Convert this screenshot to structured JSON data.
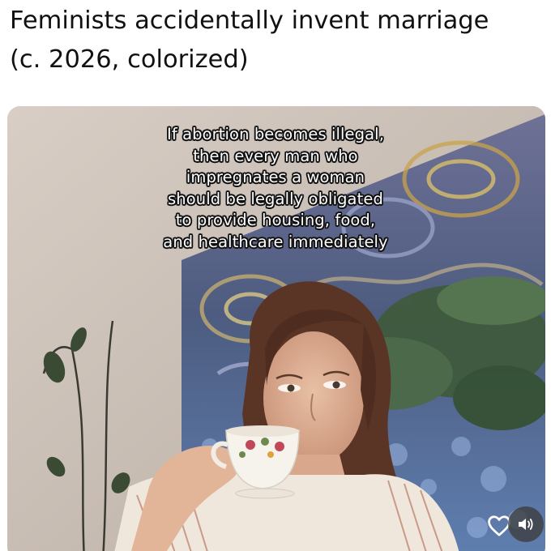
{
  "post": {
    "title": "Feminists accidentally invent marriage\n(c. 2026, colorized)"
  },
  "media": {
    "caption_lines": [
      "If abortion becomes illegal,",
      "then every man who",
      "impregnates a woman",
      "should be legally obligated",
      "to provide housing, food,",
      "and healthcare immediately"
    ],
    "controls": {
      "like_icon": "heart-outline-icon",
      "sound_icon": "speaker-icon"
    }
  },
  "colors": {
    "caption_text": "#ffffff",
    "caption_outline": "#111111",
    "wall": "#c9bfb6",
    "tapestry_blue": "#5b6a9a",
    "tapestry_green": "#3f5a3a",
    "hair": "#5a3526"
  }
}
